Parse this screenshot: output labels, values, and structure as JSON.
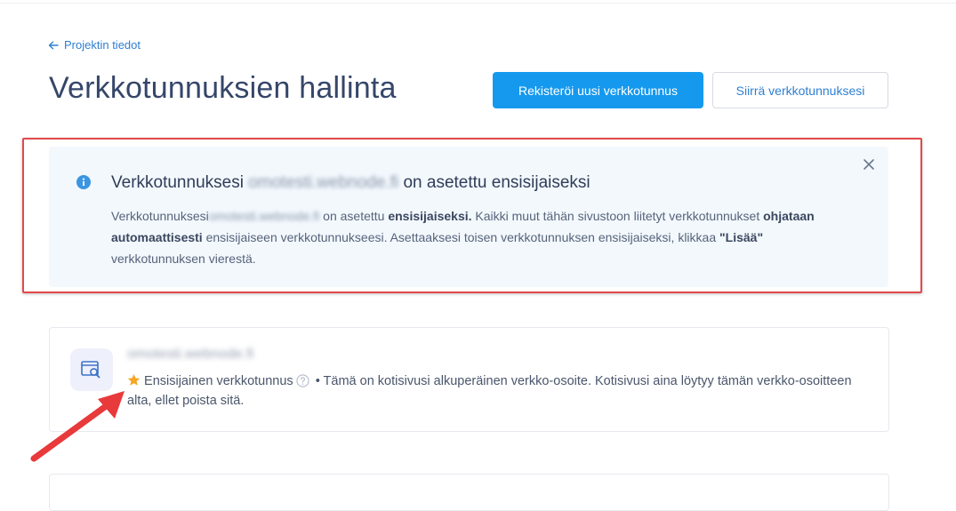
{
  "header": {
    "back_link": "Projektin tiedot",
    "title": "Verkkotunnuksien hallinta",
    "register_button": "Rekisteröi uusi verkkotunnus",
    "transfer_button": "Siirrä verkkotunnuksesi"
  },
  "notice": {
    "title_prefix": "Verkkotunnuksesi",
    "title_domain": "omotesti.webnode.fi",
    "title_suffix": "on asetettu ensisijaiseksi",
    "body": {
      "p1": "Verkkotunnuksesi",
      "domain": "omotesti.webnode.fi",
      "p2": " on asetettu ",
      "b1": "ensisijaiseksi.",
      "p3": " Kaikki muut tähän sivustoon liitetyt verkkotunnukset ",
      "b2": "ohjataan automaattisesti",
      "p4": " ensisijaiseen verkkotunnukseesi. Asettaaksesi toisen verkkotunnuksen ensisijaiseksi, klikkaa ",
      "b3": "\"Lisää\"",
      "p5": " verkkotunnuksen vierestä."
    }
  },
  "domain_card": {
    "name": "omotesti.webnode.fi",
    "primary_label": "Ensisijainen verkkotunnus",
    "description": " • Tämä on kotisivusi alkuperäinen verkko-osoite. Kotisivusi aina löytyy tämän verkko-osoitteen alta, ellet poista sitä."
  },
  "colors": {
    "primary_button": "#1599ee",
    "link": "#2f7fd0",
    "highlight_border": "#e2494b",
    "star": "#f5a623",
    "notice_bg": "#f3f8fd"
  },
  "icons": {
    "back": "arrow-left-icon",
    "info": "info-icon",
    "close": "close-icon",
    "domain": "browser-search-icon",
    "star": "star-icon",
    "help": "help-circle-icon"
  }
}
